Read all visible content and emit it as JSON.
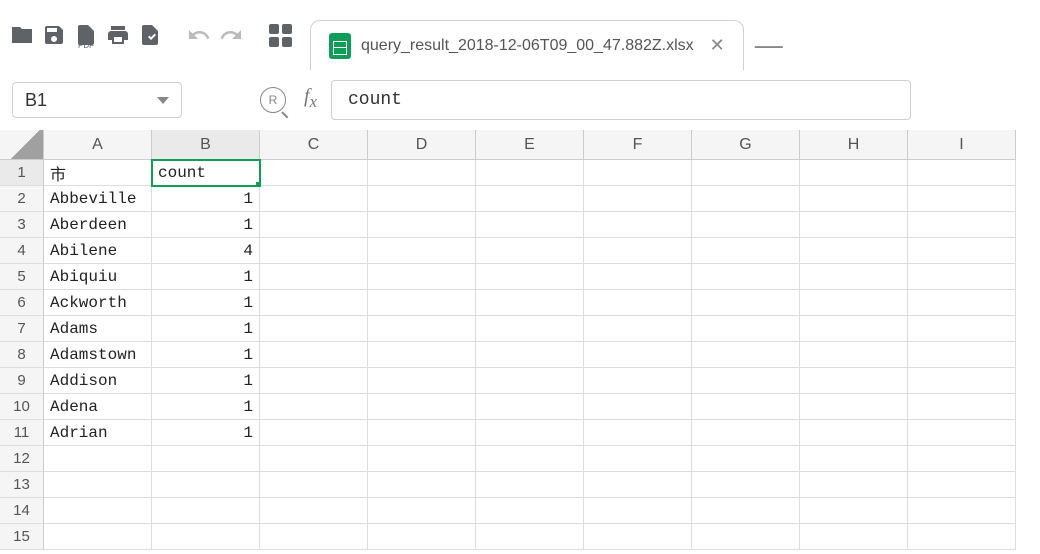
{
  "tab": {
    "title": "query_result_2018-12-06T09_00_47.882Z.xlsx"
  },
  "toolbar_labels": {
    "pdf": "PDF"
  },
  "name_box": {
    "value": "B1"
  },
  "formula": {
    "value": "count"
  },
  "columns": [
    "A",
    "B",
    "C",
    "D",
    "E",
    "F",
    "G",
    "H",
    "I"
  ],
  "rows": [
    {
      "n": "1",
      "a": "市",
      "b": "count"
    },
    {
      "n": "2",
      "a": "Abbeville",
      "b": "1"
    },
    {
      "n": "3",
      "a": "Aberdeen",
      "b": "1"
    },
    {
      "n": "4",
      "a": "Abilene",
      "b": "4"
    },
    {
      "n": "5",
      "a": "Abiquiu",
      "b": "1"
    },
    {
      "n": "6",
      "a": "Ackworth",
      "b": "1"
    },
    {
      "n": "7",
      "a": "Adams",
      "b": "1"
    },
    {
      "n": "8",
      "a": "Adamstown",
      "b": "1"
    },
    {
      "n": "9",
      "a": "Addison",
      "b": "1"
    },
    {
      "n": "10",
      "a": "Adena",
      "b": "1"
    },
    {
      "n": "11",
      "a": "Adrian",
      "b": "1"
    },
    {
      "n": "12",
      "a": "",
      "b": ""
    },
    {
      "n": "13",
      "a": "",
      "b": ""
    },
    {
      "n": "14",
      "a": "",
      "b": ""
    },
    {
      "n": "15",
      "a": "",
      "b": ""
    }
  ],
  "selected": {
    "col": "B",
    "row": 1
  }
}
